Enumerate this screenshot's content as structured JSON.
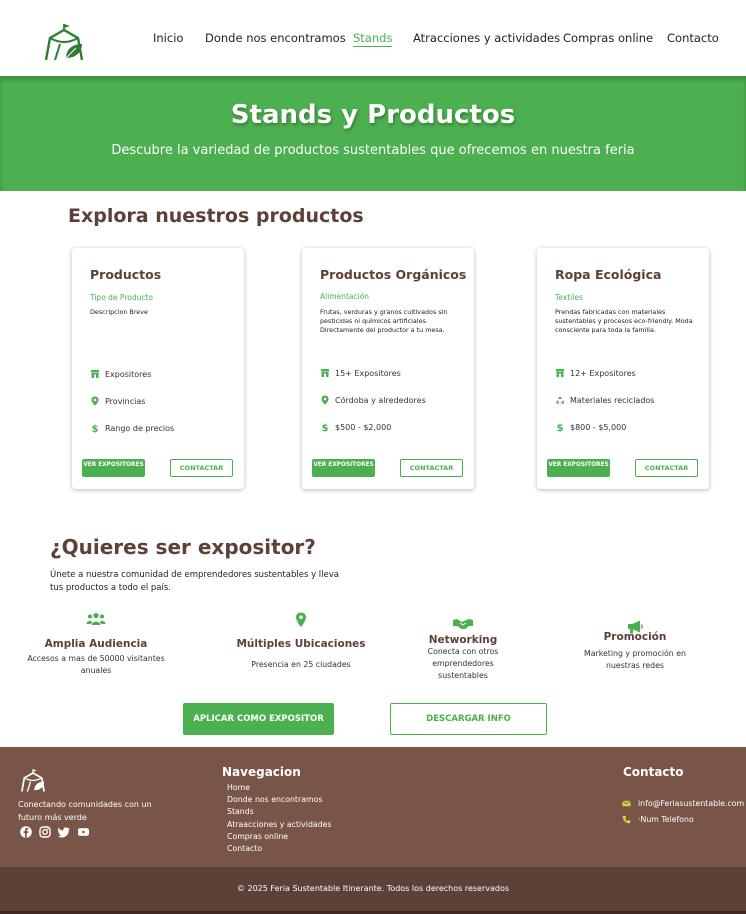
{
  "header": {
    "logo_icon": "tent-leaf-icon",
    "nav": [
      {
        "label": "Inicio",
        "active": false
      },
      {
        "label": "Donde nos encontramos",
        "active": false
      },
      {
        "label": "Stands",
        "active": true
      },
      {
        "label": "Atracciones y actividades",
        "active": false
      },
      {
        "label": "Compras online",
        "active": false
      },
      {
        "label": "Contacto",
        "active": false
      }
    ]
  },
  "hero": {
    "title": "Stands y Productos",
    "subtitle": "Descubre la variedad de productos sustentables que ofrecemos en nuestra feria"
  },
  "products": {
    "title": "Explora nuestros productos",
    "cards": [
      {
        "title": "Productos",
        "category": "Tipo de Producto",
        "description": "Descripcion Breve",
        "rows": [
          {
            "icon": "store-icon",
            "text": "Expositores"
          },
          {
            "icon": "location-pin-icon",
            "text": "Provincias"
          },
          {
            "icon": "dollar-icon",
            "text": "Rango de precios"
          }
        ],
        "view_label": "VER EXPOSITORES",
        "contact_label": "CONTACTAR"
      },
      {
        "title": "Productos Orgánicos",
        "category": "Alimentación",
        "description": "Frutas, verduras y granos cultivados sin pesticidas ni químicos artificiales. Directamente del productor a tu mesa.",
        "rows": [
          {
            "icon": "store-icon",
            "text": "15+ Expositores"
          },
          {
            "icon": "location-pin-icon",
            "text": "Córdoba y alrededores"
          },
          {
            "icon": "dollar-icon",
            "text": "$500 - $2,000"
          }
        ],
        "view_label": "VER EXPOSITORES",
        "contact_label": "CONTACTAR"
      },
      {
        "title": "Ropa Ecológica",
        "category": "Textiles",
        "description": "Prendas fabricadas con materiales sustentables y procesos eco-friendly. Moda consciente para toda la familia.",
        "rows": [
          {
            "icon": "store-icon",
            "text": "12+ Expositores"
          },
          {
            "icon": "recycle-icon",
            "text": "Materiales reciclados"
          },
          {
            "icon": "dollar-icon",
            "text": "$800 - $5,000"
          }
        ],
        "view_label": "VER EXPOSITORES",
        "contact_label": "CONTACTAR"
      }
    ]
  },
  "exhibitor": {
    "title": "¿Quieres ser expositor?",
    "text": "Únete a nuestra comunidad de emprendedores sustentables y lleva tus productos a todo el país.",
    "features": [
      {
        "icon": "users-icon",
        "title": "Amplia Audiencia",
        "text": "Accesos a mas de 50000 visitantes anuales"
      },
      {
        "icon": "location-pin-icon",
        "title": "Múltiples Ubicaciones",
        "text": "Presencia en 25 ciudades"
      },
      {
        "icon": "handshake-icon",
        "title": "Networking",
        "text": "Conecta con otros emprendedores sustentables"
      },
      {
        "icon": "megaphone-icon",
        "title": "Promoción",
        "text": "Marketing y promoción en nuestras redes"
      }
    ],
    "apply_label": "APLICAR COMO EXPOSITOR",
    "download_label": "DESCARGAR INFO"
  },
  "footer": {
    "tagline": "Conectando comunidades con un futuro más verde",
    "social_icons": [
      "facebook-icon",
      "instagram-icon",
      "twitter-icon",
      "youtube-icon"
    ],
    "nav_title": "Navegacion",
    "nav_links": [
      "Home",
      "Donde nos encontramos",
      "Stands",
      "Atraacciones y actividades",
      "Compras online",
      "Contacto"
    ],
    "contact_title": "Contacto",
    "email": "info@Feriasustentable.com",
    "phone": "Num Telefono",
    "copyright": "© 2025 Feria Sustentable Itinerante. Todos los derechos reservados"
  },
  "colors": {
    "green": "#4caf50",
    "brown_heading": "#5d4037",
    "footer_brown": "#795548",
    "bottom_bar": "#5d4037",
    "accent_yellow": "#cddc39"
  }
}
